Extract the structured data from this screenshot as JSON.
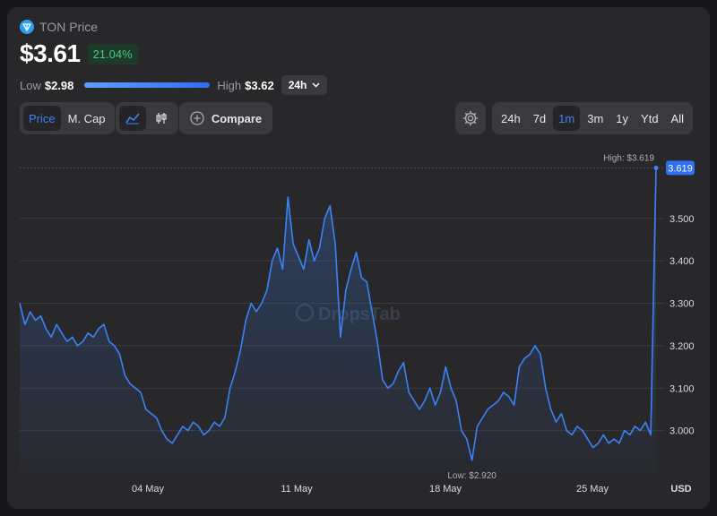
{
  "header": {
    "coin_name": "TON Price",
    "price": "$3.61",
    "change": "21.04%",
    "low_label": "Low",
    "low_value": "$2.98",
    "high_label": "High",
    "high_value": "$3.62",
    "range_timeframe": "24h"
  },
  "toolbar": {
    "metric_tabs": [
      "Price",
      "M. Cap"
    ],
    "active_metric": "Price",
    "compare_label": "Compare",
    "timeframes": [
      "24h",
      "7d",
      "1m",
      "3m",
      "1y",
      "Ytd",
      "All"
    ],
    "active_timeframe": "1m"
  },
  "colors": {
    "accent": "#3b82f6",
    "positive": "#3fd17b",
    "background": "#28282b"
  },
  "watermark": "DropsTab",
  "chart_data": {
    "type": "area",
    "x_ticks": [
      "04 May",
      "11 May",
      "18 May",
      "25 May"
    ],
    "y_ticks": [
      3.0,
      3.1,
      3.2,
      3.3,
      3.4,
      3.5
    ],
    "y_tick_labels": [
      "3.000",
      "3.100",
      "3.200",
      "3.300",
      "3.400",
      "3.500"
    ],
    "ylim": [
      2.9,
      3.66
    ],
    "currency_label": "USD",
    "high_annotation": "High: $3.619",
    "low_annotation": "Low: $2.920",
    "current_value_label": "3.619",
    "series": [
      {
        "values": [
          3.3,
          3.25,
          3.28,
          3.26,
          3.27,
          3.24,
          3.22,
          3.25,
          3.23,
          3.21,
          3.22,
          3.2,
          3.21,
          3.23,
          3.22,
          3.24,
          3.25,
          3.21,
          3.2,
          3.18,
          3.13,
          3.11,
          3.1,
          3.09,
          3.05,
          3.04,
          3.03,
          3.0,
          2.98,
          2.97,
          2.99,
          3.01,
          3.0,
          3.02,
          3.01,
          2.99,
          3.0,
          3.02,
          3.01,
          3.03,
          3.1,
          3.14,
          3.19,
          3.26,
          3.3,
          3.28,
          3.3,
          3.33,
          3.4,
          3.43,
          3.38,
          3.55,
          3.44,
          3.41,
          3.38,
          3.45,
          3.4,
          3.43,
          3.5,
          3.53,
          3.44,
          3.22,
          3.33,
          3.38,
          3.42,
          3.36,
          3.35,
          3.28,
          3.21,
          3.12,
          3.1,
          3.11,
          3.14,
          3.16,
          3.09,
          3.07,
          3.05,
          3.07,
          3.1,
          3.06,
          3.09,
          3.15,
          3.1,
          3.07,
          3.0,
          2.98,
          2.93,
          3.01,
          3.03,
          3.05,
          3.06,
          3.07,
          3.09,
          3.08,
          3.06,
          3.15,
          3.17,
          3.18,
          3.2,
          3.18,
          3.1,
          3.05,
          3.02,
          3.04,
          3.0,
          2.99,
          3.01,
          3.0,
          2.98,
          2.96,
          2.97,
          2.99,
          2.97,
          2.98,
          2.97,
          3.0,
          2.99,
          3.01,
          3.0,
          3.02,
          2.99,
          3.619
        ]
      }
    ]
  }
}
